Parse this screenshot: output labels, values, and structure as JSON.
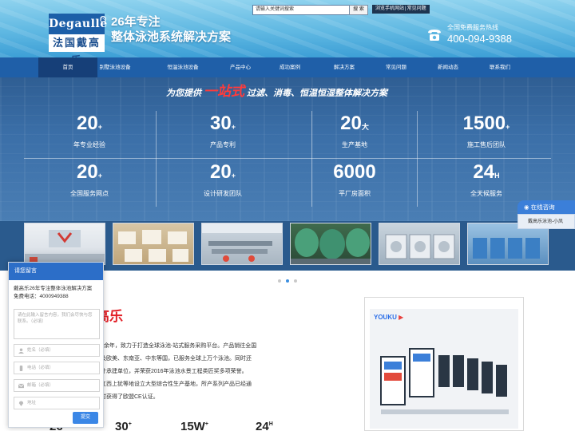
{
  "header": {
    "logo_text": "Degaulle",
    "logo_cn": "法国戴高乐",
    "slogan_line1": "26年专注",
    "slogan_line2": "整体泳池系统解决方案",
    "search_placeholder": "请输入关键词搜索",
    "search_button": "搜 索",
    "top_links": [
      "浏览手机网站",
      "常见问题"
    ],
    "hotline_label": "全国免费服务热线",
    "hotline_number": "400-094-9388"
  },
  "nav": {
    "items": [
      "首页",
      "别墅泳池设备",
      "恒温泳池设备",
      "产品中心",
      "成功案例",
      "解决方案",
      "常见问题",
      "新闻动态",
      "联系我们"
    ],
    "active_index": 0
  },
  "banner": {
    "title_prefix": "为您提供",
    "title_highlight": "一站式",
    "title_suffix": "过滤、消毒、恒温恒湿整体解决方案",
    "stats": [
      {
        "num": "20",
        "unit": "+",
        "label": "年专业经验"
      },
      {
        "num": "30",
        "unit": "+",
        "label": "产品专利"
      },
      {
        "num": "20",
        "unit": "大",
        "label": "生产基地"
      },
      {
        "num": "1500",
        "unit": "+",
        "label": "施工售后团队"
      },
      {
        "num": "20",
        "unit": "+",
        "label": "全国服务网点"
      },
      {
        "num": "20",
        "unit": "+",
        "label": "设计研发团队"
      },
      {
        "num": "6000",
        "unit": "",
        "label": "平厂房面积"
      },
      {
        "num": "24",
        "unit": "H",
        "label": "全天候服务"
      }
    ],
    "carousel_total": 3,
    "carousel_active": 1
  },
  "about": {
    "heading": "高乐",
    "lines": [
      "0余年，致力于打造全球泳池-站式服务采购平台。产品销往全国",
      "及欧美、东南亚、中东等国，已服务全球上万个泳池。同时还",
      "计承建单位，并荣获2016年泳池水景工程类匠奖多项荣誉。",
      "江西上犹等地设立大型综合性生产基地，所产系列产品已经通",
      "时获得了欧盟CE认证。"
    ],
    "mini_stats": [
      {
        "num": "26",
        "unit": "+"
      },
      {
        "num": "30",
        "unit": "+"
      },
      {
        "num": "15W",
        "unit": "+"
      },
      {
        "num": "24",
        "unit": "H"
      }
    ]
  },
  "video": {
    "brand": "YOUKU"
  },
  "consult": {
    "title": "在线咨询",
    "agent": "戴高乐泳池-小凤"
  },
  "message_panel": {
    "title": "请您留言",
    "intro": "戴高乐26年专注整体泳池解决方案",
    "phone": "免费电话：4000949388",
    "textarea_placeholder": "请在此输入留言内容，我们会尽快与您联系。（必填）",
    "name_placeholder": "姓名（必填）",
    "phone_placeholder": "电话（必填）",
    "email_placeholder": "邮箱（必填）",
    "address_placeholder": "地址",
    "submit": "提交"
  },
  "colors": {
    "nav_bg": "#1f5fa8",
    "accent_red": "#e21f26",
    "consult_blue": "#3b7fd9"
  }
}
